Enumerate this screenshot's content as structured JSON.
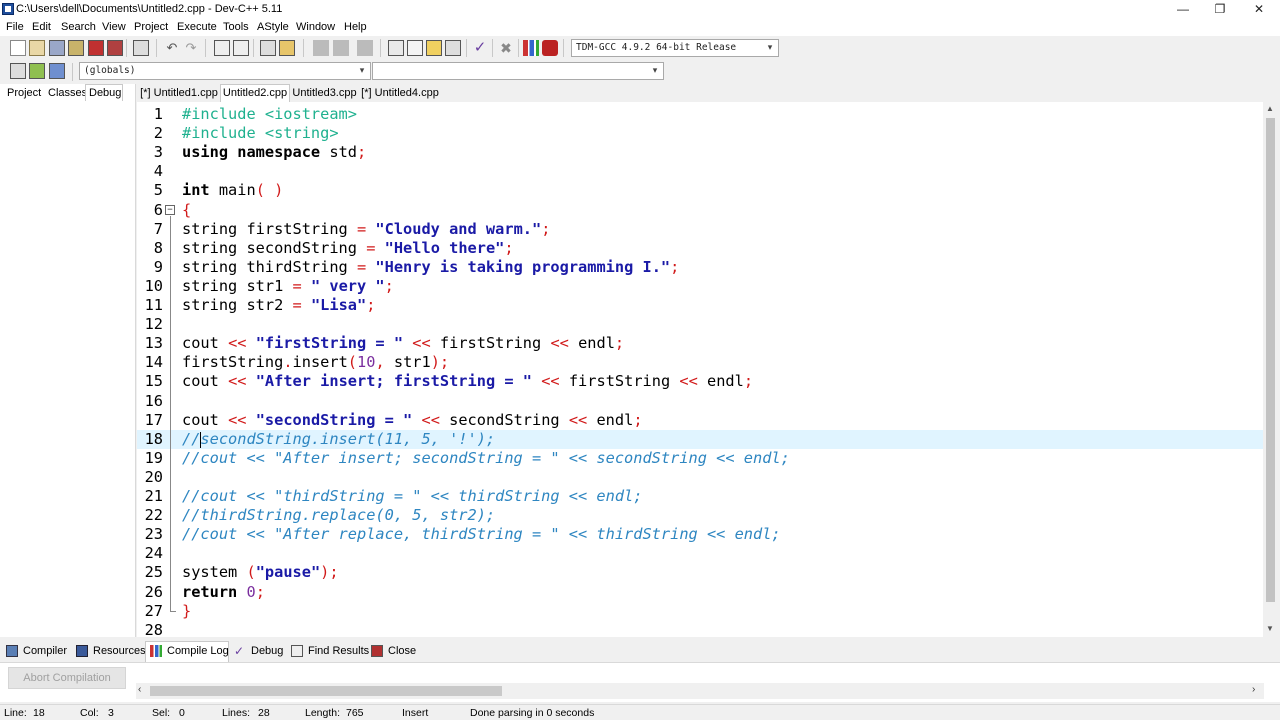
{
  "window": {
    "title": "C:\\Users\\dell\\Documents\\Untitled2.cpp - Dev-C++ 5.11",
    "minimize": "—",
    "restore": "❐",
    "close": "✕"
  },
  "menu": [
    "File",
    "Edit",
    "Search",
    "View",
    "Project",
    "Execute",
    "Tools",
    "AStyle",
    "Window",
    "Help"
  ],
  "toolbar": {
    "compiler_select": "TDM-GCC 4.9.2 64-bit Release",
    "scope_select": "(globals)",
    "function_select": ""
  },
  "left_tabs": [
    "Project",
    "Classes",
    "Debug"
  ],
  "left_active_tab": "Debug",
  "editor_tabs": [
    "[*] Untitled1.cpp",
    "Untitled2.cpp",
    "Untitled3.cpp",
    "[*] Untitled4.cpp"
  ],
  "editor_active_tab": "Untitled2.cpp",
  "current_line": 18,
  "bottom_tabs": [
    "Compiler",
    "Resources",
    "Compile Log",
    "Debug",
    "Find Results",
    "Close"
  ],
  "bottom_active_tab": "Compile Log",
  "abort_button": "Abort Compilation",
  "status": {
    "line_label": "Line:",
    "line_value": "18",
    "col_label": "Col:",
    "col_value": "3",
    "sel_label": "Sel:",
    "sel_value": "0",
    "lines_label": "Lines:",
    "lines_value": "28",
    "length_label": "Length:",
    "length_value": "765",
    "mode": "Insert",
    "message": "Done parsing in 0 seconds"
  },
  "colors": {
    "preprocessor": "#1fb18f",
    "string": "#1a1aa6",
    "operator": "#d11a1a",
    "number": "#7a2e9e",
    "comment": "#2e86c1",
    "current_line_bg": "#e0f4ff"
  },
  "code": [
    [
      [
        "pp",
        "#include <iostream>"
      ]
    ],
    [
      [
        "pp",
        "#include <string>"
      ]
    ],
    [
      [
        "kw",
        "using namespace "
      ],
      [
        "",
        "std"
      ],
      [
        "sym",
        ";"
      ]
    ],
    [],
    [
      [
        "kw",
        "int "
      ],
      [
        "",
        "main"
      ],
      [
        "sym",
        "( )"
      ]
    ],
    [
      [
        "sym",
        "{"
      ]
    ],
    [
      [
        "",
        "string firstString "
      ],
      [
        "op",
        "="
      ],
      [
        "",
        " "
      ],
      [
        "str",
        "\"Cloudy and warm.\""
      ],
      [
        "sym",
        ";"
      ]
    ],
    [
      [
        "",
        "string secondString "
      ],
      [
        "op",
        "="
      ],
      [
        "",
        " "
      ],
      [
        "str",
        "\"Hello there\""
      ],
      [
        "sym",
        ";"
      ]
    ],
    [
      [
        "",
        "string thirdString "
      ],
      [
        "op",
        "="
      ],
      [
        "",
        " "
      ],
      [
        "str",
        "\"Henry is taking programming I.\""
      ],
      [
        "sym",
        ";"
      ]
    ],
    [
      [
        "",
        "string str1 "
      ],
      [
        "op",
        "="
      ],
      [
        "",
        " "
      ],
      [
        "str",
        "\" very \""
      ],
      [
        "sym",
        ";"
      ]
    ],
    [
      [
        "",
        "string str2 "
      ],
      [
        "op",
        "="
      ],
      [
        "",
        " "
      ],
      [
        "str",
        "\"Lisa\""
      ],
      [
        "sym",
        ";"
      ]
    ],
    [],
    [
      [
        "",
        "cout "
      ],
      [
        "op",
        "<<"
      ],
      [
        "",
        " "
      ],
      [
        "str",
        "\"firstString = \""
      ],
      [
        "",
        " "
      ],
      [
        "op",
        "<<"
      ],
      [
        "",
        " firstString "
      ],
      [
        "op",
        "<<"
      ],
      [
        "",
        " endl"
      ],
      [
        "sym",
        ";"
      ]
    ],
    [
      [
        "",
        "firstString"
      ],
      [
        "sym",
        "."
      ],
      [
        "",
        "insert"
      ],
      [
        "sym",
        "("
      ],
      [
        "num",
        "10"
      ],
      [
        "sym",
        ","
      ],
      [
        "",
        " str1"
      ],
      [
        "sym",
        ");"
      ]
    ],
    [
      [
        "",
        "cout "
      ],
      [
        "op",
        "<<"
      ],
      [
        "",
        " "
      ],
      [
        "str",
        "\"After insert; firstString = \""
      ],
      [
        "",
        " "
      ],
      [
        "op",
        "<<"
      ],
      [
        "",
        " firstString "
      ],
      [
        "op",
        "<<"
      ],
      [
        "",
        " endl"
      ],
      [
        "sym",
        ";"
      ]
    ],
    [],
    [
      [
        "",
        "cout "
      ],
      [
        "op",
        "<<"
      ],
      [
        "",
        " "
      ],
      [
        "str",
        "\"secondString = \""
      ],
      [
        "",
        " "
      ],
      [
        "op",
        "<<"
      ],
      [
        "",
        " secondString "
      ],
      [
        "op",
        "<<"
      ],
      [
        "",
        " endl"
      ],
      [
        "sym",
        ";"
      ]
    ],
    [
      [
        "cm",
        "//secondString.insert(11, 5, '!');"
      ]
    ],
    [
      [
        "cm",
        "//cout << \"After insert; secondString = \" << secondString << endl;"
      ]
    ],
    [],
    [
      [
        "cm",
        "//cout << \"thirdString = \" << thirdString << endl;"
      ]
    ],
    [
      [
        "cm",
        "//thirdString.replace(0, 5, str2);"
      ]
    ],
    [
      [
        "cm",
        "//cout << \"After replace, thirdString = \" << thirdString << endl;"
      ]
    ],
    [],
    [
      [
        "",
        "system "
      ],
      [
        "sym",
        "("
      ],
      [
        "str",
        "\"pause\""
      ],
      [
        "sym",
        ");"
      ]
    ],
    [
      [
        "kw",
        "return "
      ],
      [
        "num",
        "0"
      ],
      [
        "sym",
        ";"
      ]
    ],
    [
      [
        "sym",
        "}"
      ]
    ],
    []
  ]
}
